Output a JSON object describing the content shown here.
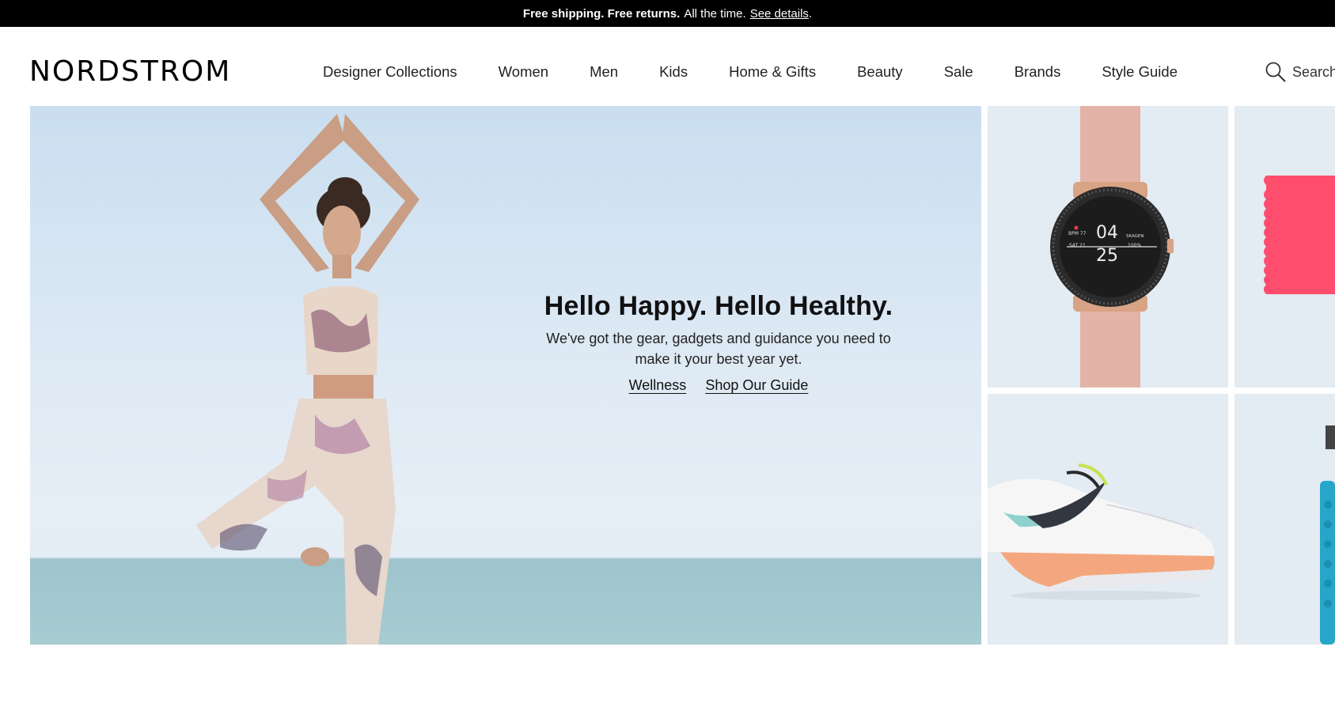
{
  "promo": {
    "bold_text": "Free shipping. Free returns.",
    "text": "All the time.",
    "link": "See details",
    "trailing": "."
  },
  "header": {
    "logo": "NORDSTROM",
    "nav": [
      "Designer Collections",
      "Women",
      "Men",
      "Kids",
      "Home & Gifts",
      "Beauty",
      "Sale",
      "Brands",
      "Style Guide"
    ],
    "search_label": "Search"
  },
  "hero": {
    "title": "Hello Happy. Hello Healthy.",
    "subtitle": "We've got the gear, gadgets and guidance you need to make it your best year yet.",
    "links": [
      "Wellness",
      "Shop Our Guide"
    ]
  },
  "tiles": {
    "watch": {
      "bpm": "BPM 77",
      "hour": "04",
      "brand": "SKAGEN",
      "date": "SAT 21",
      "minute": "25",
      "battery": "100%"
    }
  },
  "colors": {
    "promo_bg": "#000000",
    "accent_pink": "#ff4d6d",
    "tile_bg": "#e3ebf3"
  }
}
